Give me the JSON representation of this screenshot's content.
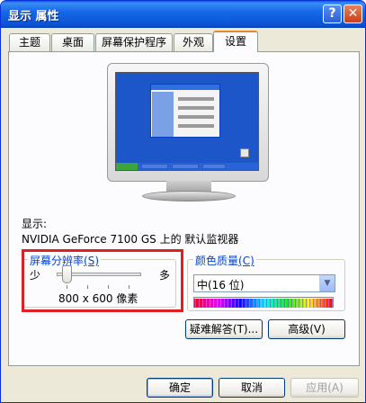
{
  "window": {
    "title": "显示 属性",
    "help_btn": "?",
    "close_btn": "✕"
  },
  "tabs": [
    {
      "label": "主题"
    },
    {
      "label": "桌面"
    },
    {
      "label": "屏幕保护程序"
    },
    {
      "label": "外观"
    },
    {
      "label": "设置",
      "active": true
    }
  ],
  "display": {
    "label": "显示:",
    "device": "NVIDIA GeForce 7100 GS 上的 默认监视器"
  },
  "resolution": {
    "legend": "屏幕分辨率",
    "hotkey": "(S)",
    "min_label": "少",
    "max_label": "多",
    "value": "800 x 600 像素",
    "slider_position": 0
  },
  "color_quality": {
    "legend": "颜色质量",
    "hotkey": "(C)",
    "selected": "中(16 位)",
    "arrow_icon": "chevron-down-icon"
  },
  "buttons": {
    "troubleshoot": "疑难解答(T)...",
    "advanced": "高级(V)",
    "ok": "确定",
    "cancel": "取消",
    "apply": "应用(A)"
  },
  "colors": {
    "title_bar": "#0a54d6",
    "highlight_box": "#e02020",
    "tab_active_border": "#e68b2c"
  }
}
